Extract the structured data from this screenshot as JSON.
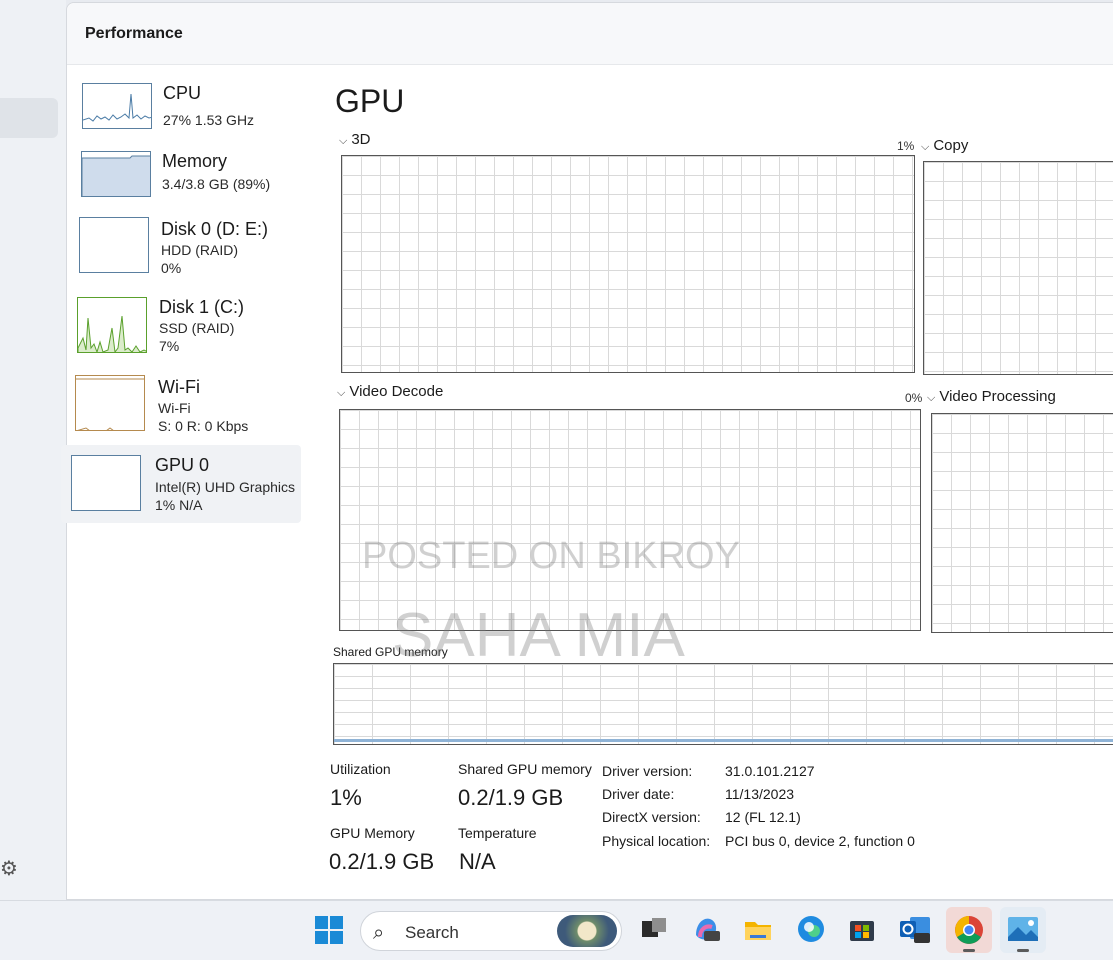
{
  "window": {
    "title": "Performance"
  },
  "sidebar": {
    "devices": [
      {
        "name": "CPU",
        "line1": "27%  1.53 GHz",
        "line2": ""
      },
      {
        "name": "Memory",
        "line1": "3.4/3.8 GB (89%)",
        "line2": ""
      },
      {
        "name": "Disk 0 (D: E:)",
        "line1": "HDD (RAID)",
        "line2": "0%"
      },
      {
        "name": "Disk 1 (C:)",
        "line1": "SSD (RAID)",
        "line2": "7%"
      },
      {
        "name": "Wi-Fi",
        "line1": "Wi-Fi",
        "line2": "S: 0  R: 0 Kbps"
      },
      {
        "name": "GPU 0",
        "line1": "Intel(R) UHD Graphics",
        "line2": "1%  N/A"
      }
    ],
    "selected_index": 5
  },
  "gpu": {
    "title": "GPU",
    "engines": [
      {
        "label": "3D",
        "percent": "1%"
      },
      {
        "label": "Copy",
        "percent": ""
      },
      {
        "label": "Video Decode",
        "percent": "0%"
      },
      {
        "label": "Video Processing",
        "percent": ""
      }
    ],
    "shared_graph_label": "Shared GPU memory",
    "stats": {
      "utilization_label": "Utilization",
      "utilization_value": "1%",
      "shared_mem_label": "Shared GPU memory",
      "shared_mem_value": "0.2/1.9 GB",
      "gpu_mem_label": "GPU Memory",
      "gpu_mem_value": "0.2/1.9 GB",
      "temp_label": "Temperature",
      "temp_value": "N/A"
    },
    "details": [
      {
        "label": "Driver version:",
        "value": "31.0.101.2127"
      },
      {
        "label": "Driver date:",
        "value": "11/13/2023"
      },
      {
        "label": "DirectX version:",
        "value": "12 (FL 12.1)"
      },
      {
        "label": "Physical location:",
        "value": "PCI bus 0, device 2, function 0"
      }
    ]
  },
  "watermark": {
    "line1": "POSTED ON BIKROY",
    "line2": "SAHA MIA"
  },
  "taskbar": {
    "search_placeholder": "Search",
    "icons": [
      "windows-start-icon",
      "task-view-icon",
      "copilot-icon",
      "file-explorer-icon",
      "edge-icon",
      "store-icon",
      "outlook-icon",
      "chrome-icon",
      "photos-icon"
    ]
  },
  "colors": {
    "accent": "#5a7fa0",
    "memory_fill": "#cfdcec",
    "disk1_line": "#5aa02c",
    "wifi_border": "#b58a4e"
  }
}
